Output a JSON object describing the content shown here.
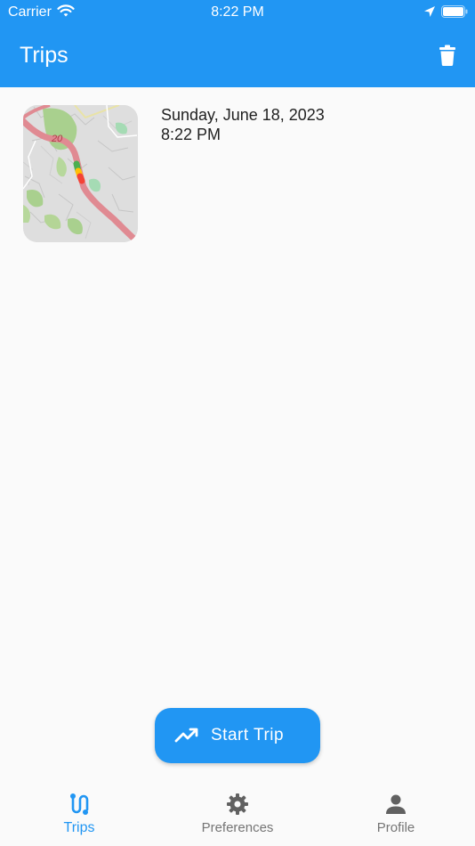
{
  "status_bar": {
    "carrier": "Carrier",
    "time": "8:22 PM"
  },
  "header": {
    "title": "Trips",
    "delete_icon": "trash-icon"
  },
  "trips": [
    {
      "date": "Sunday, June 18, 2023",
      "time": "8:22 PM",
      "map_road_label": "20"
    }
  ],
  "fab": {
    "label": "Start Trip",
    "icon": "trending-up-icon"
  },
  "tabs": [
    {
      "label": "Trips",
      "icon": "route-icon",
      "active": true
    },
    {
      "label": "Preferences",
      "icon": "gear-icon",
      "active": false
    },
    {
      "label": "Profile",
      "icon": "person-icon",
      "active": false
    }
  ],
  "colors": {
    "primary": "#2196f3",
    "inactive": "#757575",
    "background": "#fafafa"
  }
}
